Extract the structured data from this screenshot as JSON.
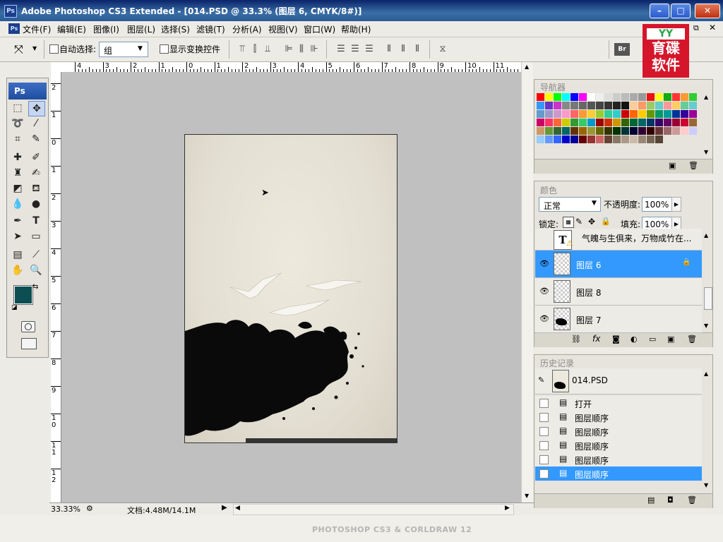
{
  "window": {
    "title": "Adobe Photoshop CS3 Extended - [014.PSD @ 33.3% (图层 6, CMYK/8#)]",
    "app_icon": "Ps"
  },
  "menu": [
    "文件(F)",
    "编辑(E)",
    "图像(I)",
    "图层(L)",
    "选择(S)",
    "滤镜(T)",
    "分析(A)",
    "视图(V)",
    "窗口(W)",
    "帮助(H)"
  ],
  "options": {
    "auto_select_label": "自动选择:",
    "auto_select_value": "组",
    "show_transform_label": "显示变换控件"
  },
  "logo": {
    "text1": "育碟",
    "text2": "软件"
  },
  "tools_header": "Ps",
  "ruler_h": [
    "4",
    "3",
    "2",
    "1",
    "0",
    "1",
    "2",
    "3",
    "4",
    "5",
    "6",
    "7",
    "8",
    "9",
    "10",
    "11"
  ],
  "ruler_v": [
    "2",
    "1",
    "0",
    "1",
    "2",
    "3",
    "4",
    "5",
    "6",
    "7",
    "8",
    "9",
    "1 0",
    "1 1",
    "1 2"
  ],
  "status": {
    "zoom": "33.33%",
    "doc": "文档:4.48M/14.1M"
  },
  "navigator_tab": "导航器",
  "swatches": [
    "#ff0000",
    "#ffff00",
    "#00ff00",
    "#00ffff",
    "#0000ff",
    "#ff00ff",
    "#ffffff",
    "#eeeeee",
    "#dddddd",
    "#cccccc",
    "#bbbbbb",
    "#aaaaaa",
    "#999999",
    "#ee1111",
    "#ffff22",
    "#11aa11",
    "#ff3333",
    "#ff9933",
    "#33cc33",
    "#3399ff",
    "#6633cc",
    "#cc33cc",
    "#888888",
    "#777777",
    "#666666",
    "#555555",
    "#444444",
    "#333333",
    "#222222",
    "#111111",
    "#ffcc99",
    "#ff9966",
    "#99cc66",
    "#66cccc",
    "#ff9999",
    "#ffcc66",
    "#66cc99",
    "#66cccc",
    "#6699cc",
    "#9999cc",
    "#cc99cc",
    "#ff99cc",
    "#ff6666",
    "#ff9933",
    "#ffcc33",
    "#99cc33",
    "#33cc99",
    "#33cccc",
    "#cc0000",
    "#ff6600",
    "#ffcc00",
    "#669900",
    "#009966",
    "#009999",
    "#003399",
    "#330099",
    "#990099",
    "#cc0066",
    "#ff3366",
    "#ff6633",
    "#cccc00",
    "#339933",
    "#33cc66",
    "#0099cc",
    "#990000",
    "#cc3300",
    "#cc9900",
    "#336600",
    "#006633",
    "#006666",
    "#003366",
    "#330066",
    "#660066",
    "#990033",
    "#cc0033",
    "#996633",
    "#cc9966",
    "#669933",
    "#336633",
    "#006666",
    "#663300",
    "#996600",
    "#999933",
    "#666600",
    "#333300",
    "#003300",
    "#003333",
    "#000033",
    "#330033",
    "#330000",
    "#663333",
    "#996666",
    "#cc9999",
    "#ffcccc",
    "#ccccff",
    "#99ccff",
    "#6699ff",
    "#3366ff",
    "#0000cc",
    "#000099",
    "#660000",
    "#993333",
    "#cc6666",
    "#664433",
    "#887766",
    "#aa9988",
    "#ccbbaa",
    "#998877",
    "#776655",
    "#554433"
  ],
  "layers_panel": {
    "tab": "颜色",
    "blend_mode": "正常",
    "opacity_label": "不透明度:",
    "opacity_value": "100%",
    "lock_label": "锁定:",
    "fill_label": "填充:",
    "fill_value": "100%",
    "layers": [
      {
        "name": "气魄与生俱来，万物成竹在...",
        "type": "text",
        "visible": false,
        "selected": false
      },
      {
        "name": "图层 6",
        "type": "pixel",
        "visible": true,
        "selected": true
      },
      {
        "name": "图层 8",
        "type": "pixel",
        "visible": true,
        "selected": false
      },
      {
        "name": "图层 7",
        "type": "pixel",
        "visible": true,
        "selected": false
      }
    ]
  },
  "history_panel": {
    "tab": "历史记录",
    "snapshot": "014.PSD",
    "items": [
      "打开",
      "图层顺序",
      "图层顺序",
      "图层顺序",
      "图层顺序",
      "图层顺序"
    ],
    "selected_index": 5
  },
  "watermark": "PHOTOSHOP CS3 & CORLDRAW 12"
}
